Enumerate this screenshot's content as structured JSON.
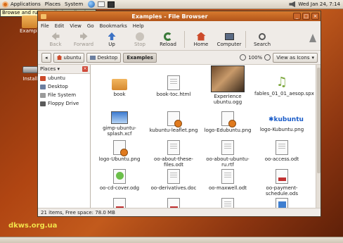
{
  "top_panel": {
    "menus": [
      "Applications",
      "Places",
      "System"
    ],
    "clock": "Wed Jan 24,  7:14",
    "icons": [
      "ubuntu-logo-icon",
      "globe-icon",
      "mail-icon",
      "terminal-icon",
      "volume-icon"
    ]
  },
  "tooltip": {
    "text": "Browse and run installed applications"
  },
  "desktop": {
    "icons": [
      {
        "label": "Example",
        "icon": "folder-icon"
      },
      {
        "label": "Install",
        "icon": "drive-icon"
      }
    ]
  },
  "window": {
    "title": "Examples - File Browser",
    "menu": [
      "File",
      "Edit",
      "View",
      "Go",
      "Bookmarks",
      "Help"
    ],
    "toolbar": {
      "back": "Back",
      "forward": "Forward",
      "up": "Up",
      "stop": "Stop",
      "reload": "Reload",
      "home": "Home",
      "computer": "Computer",
      "search": "Search"
    },
    "location": {
      "crumbs": [
        "ubuntu",
        "Desktop",
        "Examples"
      ],
      "zoom": "100%",
      "view_mode": "View as Icons"
    },
    "sidebar": {
      "title": "Places",
      "items": [
        "ubuntu",
        "Desktop",
        "File System",
        "Floppy Drive"
      ]
    },
    "files": [
      {
        "name": "book",
        "icon": "folder-icon"
      },
      {
        "name": "book-toc.html",
        "icon": "html-file-icon"
      },
      {
        "name": "Experience ubuntu.ogg",
        "icon": "video-thumbnail-icon"
      },
      {
        "name": "fables_01_01_aesop.spx",
        "icon": "music-icon"
      },
      {
        "name": "gimp-ubuntu-splash.xcf",
        "icon": "image-icon"
      },
      {
        "name": "kubuntu-leaflet.png",
        "icon": "image-badge-icon"
      },
      {
        "name": "logo-Edubuntu.png",
        "icon": "image-badge-icon"
      },
      {
        "name": "logo-Kubuntu.png",
        "icon": "kubuntu-logo-icon"
      },
      {
        "name": "logo-Ubuntu.png",
        "icon": "image-badge-icon"
      },
      {
        "name": "oo-about-these-files.odt",
        "icon": "document-icon"
      },
      {
        "name": "oo-about-ubuntu-ru.rtf",
        "icon": "document-icon"
      },
      {
        "name": "oo-access.odt",
        "icon": "document-icon"
      },
      {
        "name": "oo-cd-cover.odg",
        "icon": "drawing-icon"
      },
      {
        "name": "oo-derivatives.doc",
        "icon": "document-icon"
      },
      {
        "name": "oo-maxwell.odt",
        "icon": "document-icon"
      },
      {
        "name": "oo-payment-schedule.ods",
        "icon": "spreadsheet-icon"
      }
    ],
    "status": "21 items, Free space: 78.0 MB"
  },
  "watermark": "dkws.org.ua"
}
